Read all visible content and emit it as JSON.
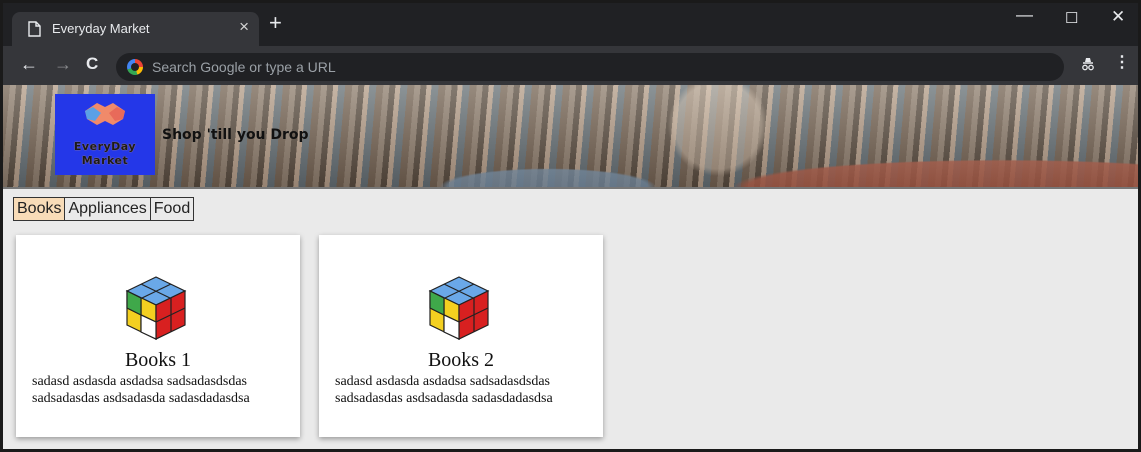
{
  "browser": {
    "tab_title": "Everyday Market",
    "tab_close": "×",
    "new_tab": "+",
    "omnibox_placeholder": "Search Google or type a URL",
    "window_controls": {
      "minimize": "—",
      "maximize": "☐",
      "close": "✕"
    },
    "nav": {
      "back": "←",
      "forward": "→",
      "reload": "C",
      "menu": "⋮"
    }
  },
  "site": {
    "logo_line1": "EveryDay",
    "logo_line2": "Market",
    "tagline": "Shop 'till you Drop"
  },
  "categories": [
    {
      "label": "Books",
      "active": true
    },
    {
      "label": "Appliances",
      "active": false
    },
    {
      "label": "Food",
      "active": false
    }
  ],
  "products": [
    {
      "title": "Books 1",
      "description": "sadasd asdasda asdadsa sadsadasdsdas sadsadasdas asdsadasda sadasdadasdsa",
      "icon": "rubiks-cube-icon"
    },
    {
      "title": "Books 2",
      "description": "sadasd asdasda asdadsa sadsadasdsdas sadsadasdas asdsadasda sadasdadasdsa",
      "icon": "rubiks-cube-icon"
    }
  ],
  "colors": {
    "logo_bg": "#2437e8",
    "active_tab_bg": "#f8dcb8",
    "page_bg": "#eaeaea"
  }
}
